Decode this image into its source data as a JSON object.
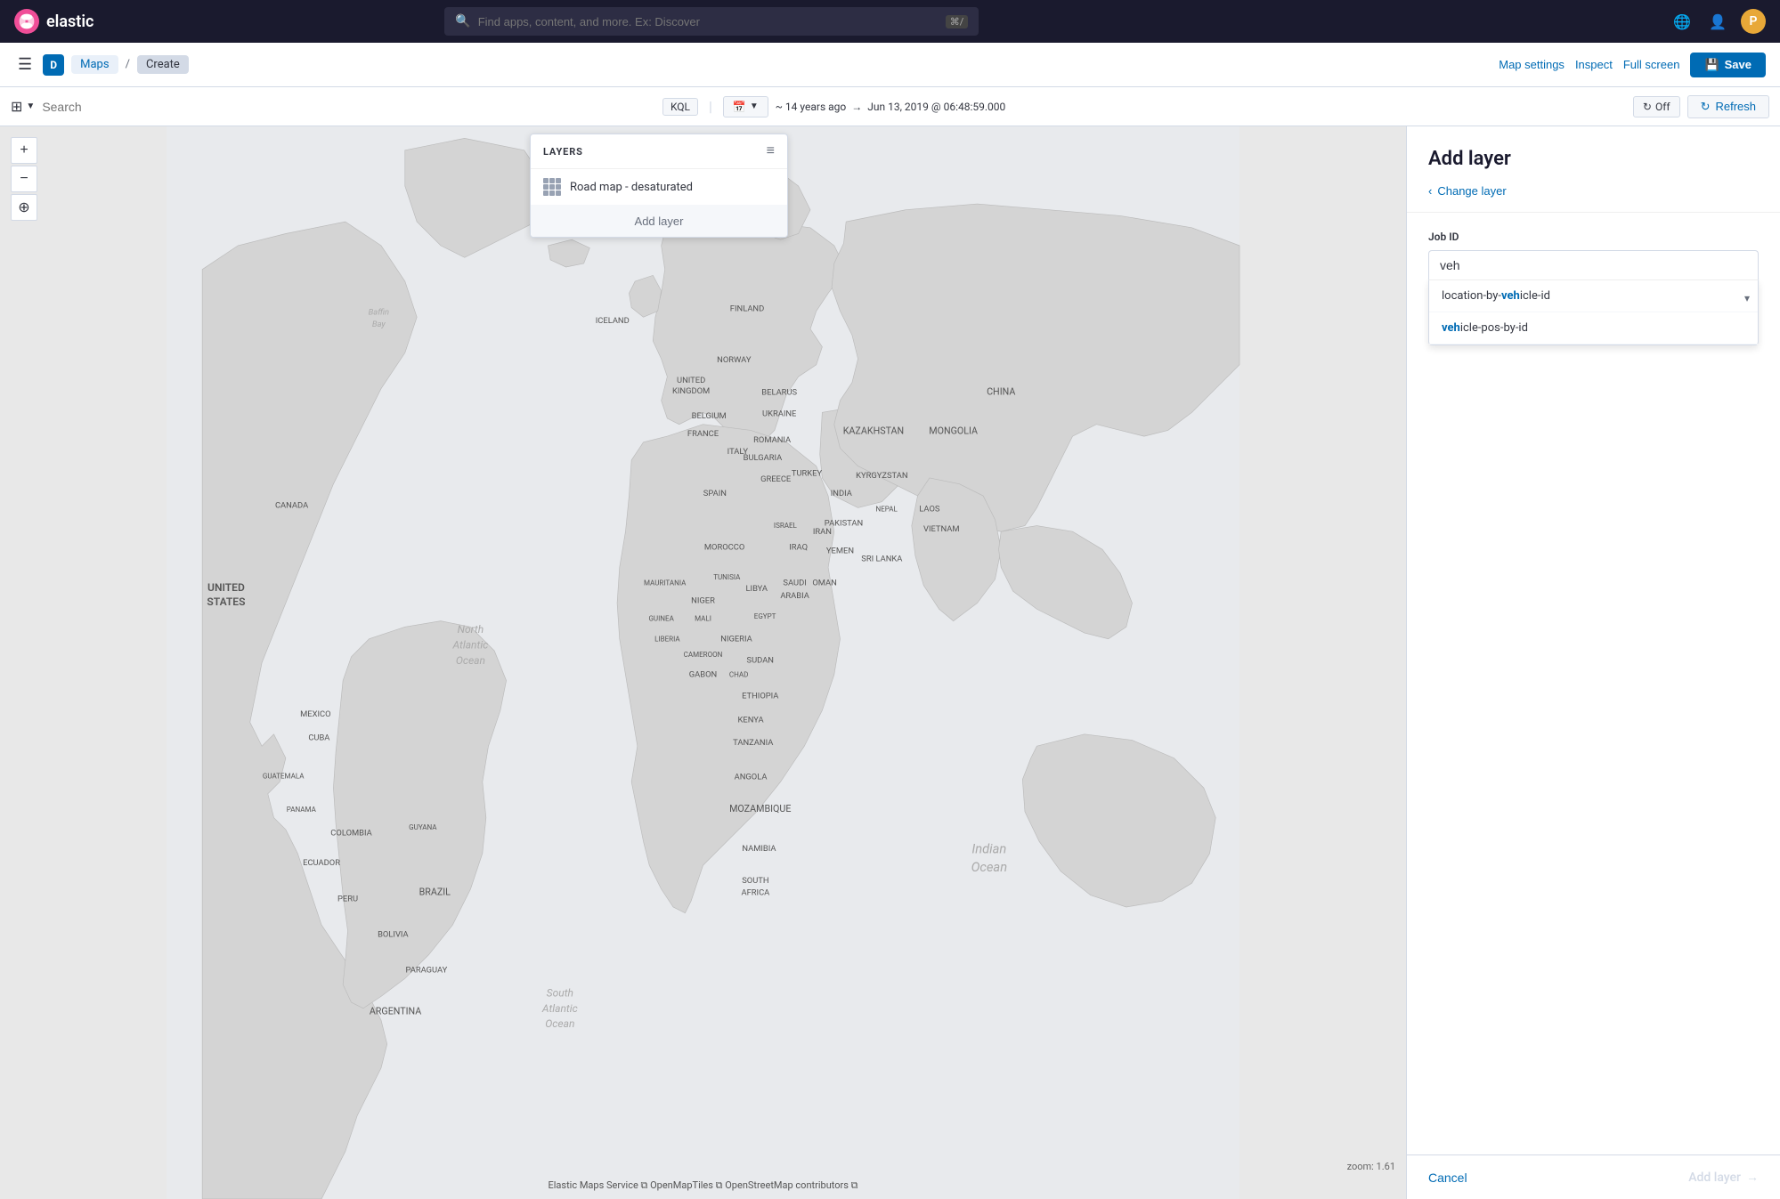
{
  "app": {
    "name": "elastic",
    "logo_text": "elastic"
  },
  "topnav": {
    "search_placeholder": "Find apps, content, and more. Ex: Discover",
    "kbd_shortcut": "⌘/",
    "user_initial": "P"
  },
  "second_toolbar": {
    "d_label": "D",
    "breadcrumbs": [
      "Maps",
      "Create"
    ],
    "map_settings": "Map settings",
    "inspect": "Inspect",
    "full_screen": "Full screen",
    "save": "Save"
  },
  "filter_bar": {
    "search_placeholder": "Search",
    "kql_label": "KQL",
    "time_ago": "~ 14 years ago",
    "arrow": "→",
    "date_time": "Jun 13, 2019 @ 06:48:59.000",
    "off_label": "Off",
    "refresh_label": "Refresh"
  },
  "layers_panel": {
    "title": "LAYERS",
    "items": [
      {
        "name": "Road map - desaturated"
      }
    ],
    "add_layer": "Add layer"
  },
  "map": {
    "zoom": "zoom: 1.61",
    "attribution": "Elastic Maps Service ⧉   OpenMapTiles ⧉   OpenStreetMap contributors ⧉",
    "ocean_labels": [
      {
        "id": "north-atlantic",
        "text": "North\nAtlantic\nOcean",
        "top": "430",
        "left": "255"
      },
      {
        "id": "indian-ocean",
        "text": "Indian\nOcean",
        "top": "600",
        "left": "700"
      },
      {
        "id": "south-atlantic",
        "text": "South\nAtlantic\nOcean",
        "top": "760",
        "left": "350"
      }
    ]
  },
  "right_panel": {
    "title": "Add layer",
    "change_layer": "Change layer",
    "job_id_label": "Job ID",
    "job_id_value": "veh",
    "dropdown_options": [
      {
        "prefix": "location-by-",
        "highlight": "veh",
        "suffix": "icle-id",
        "full": "location-by-vehicle-id"
      },
      {
        "prefix": "",
        "highlight": "veh",
        "suffix": "icle-pos-by-id",
        "full": "vehicle-pos-by-id"
      }
    ],
    "cancel_label": "Cancel",
    "add_layer_label": "Add layer",
    "add_layer_arrow": "→"
  }
}
